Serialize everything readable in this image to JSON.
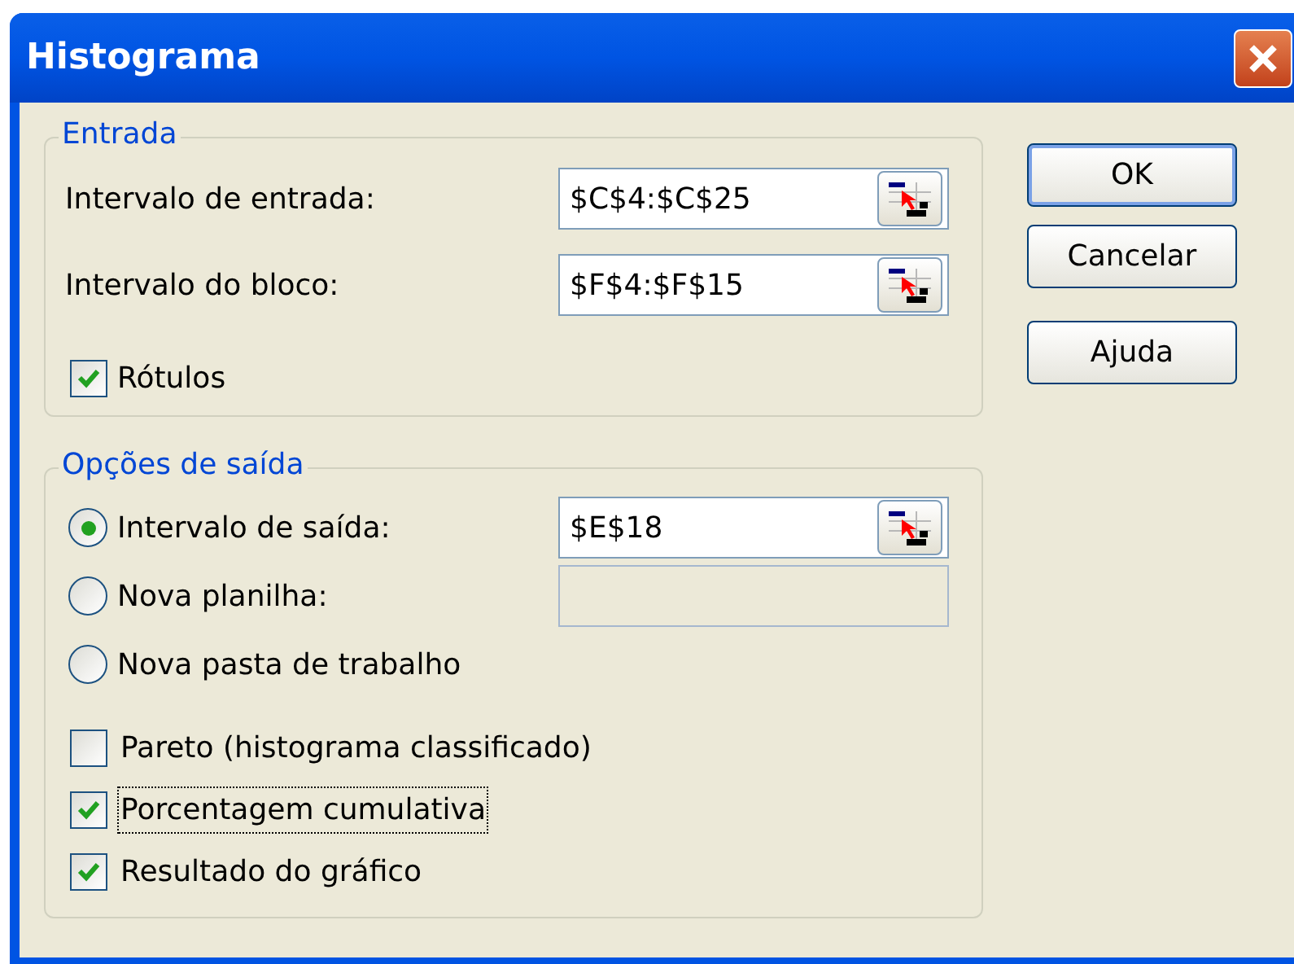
{
  "window": {
    "title": "Histograma"
  },
  "input_group": {
    "title": "Entrada",
    "fields": [
      {
        "label": "Intervalo de entrada:",
        "value": "$C$4:$C$25"
      },
      {
        "label": "Intervalo do bloco:",
        "value": "$F$4:$F$15"
      }
    ],
    "labels_checkbox": {
      "label": "Rótulos",
      "checked": true
    }
  },
  "output_group": {
    "title": "Opções de saída",
    "options": [
      {
        "label": "Intervalo de saída:",
        "selected": true,
        "field": {
          "value": "$E$18",
          "disabled": false
        }
      },
      {
        "label": "Nova planilha:",
        "selected": false,
        "field": {
          "disabled": true
        }
      },
      {
        "label": "Nova pasta de trabalho",
        "selected": false
      }
    ],
    "checkboxes": [
      {
        "label": "Pareto (histograma classificado)",
        "checked": false,
        "focused": false
      },
      {
        "label": "Porcentagem cumulativa",
        "checked": true,
        "focused": true
      },
      {
        "label": "Resultado do gráfico",
        "checked": true,
        "focused": false
      }
    ]
  },
  "buttons": [
    {
      "label": "OK",
      "default": true
    },
    {
      "label": "Cancelar",
      "default": false
    },
    {
      "label": "Ajuda",
      "default": false
    }
  ]
}
